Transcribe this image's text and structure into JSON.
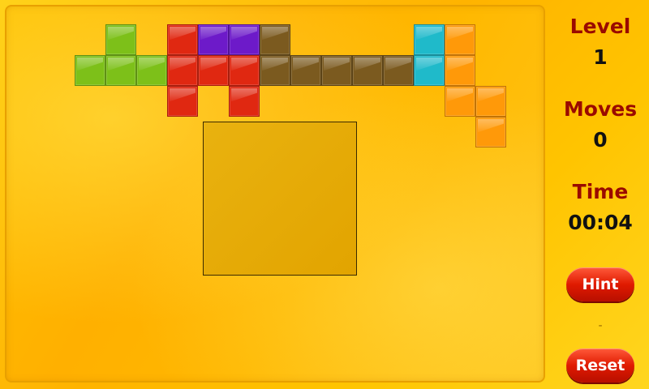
{
  "panel": {
    "level_label": "Level",
    "level_value": "1",
    "moves_label": "Moves",
    "moves_value": "0",
    "time_label": "Time",
    "time_value": "00:04",
    "hint_label": "Hint",
    "separator": "-",
    "reset_label": "Reset"
  },
  "pieces": [
    {
      "name": "green-piece",
      "color": "#7fbf20",
      "cells": [
        [
          2,
          0
        ],
        [
          1,
          1
        ],
        [
          2,
          1
        ],
        [
          3,
          1
        ]
      ]
    },
    {
      "name": "red-piece",
      "color": "#d92a14",
      "cells": [
        [
          4,
          0
        ],
        [
          4,
          1
        ],
        [
          5,
          1
        ],
        [
          6,
          1
        ],
        [
          4,
          2
        ],
        [
          6,
          2
        ]
      ]
    },
    {
      "name": "purple-piece",
      "color": "#6a1bc2",
      "cells": [
        [
          5,
          0
        ],
        [
          6,
          0
        ]
      ]
    },
    {
      "name": "brown-piece",
      "color": "#7a5a22",
      "cells": [
        [
          7,
          0
        ],
        [
          7,
          1
        ],
        [
          8,
          1
        ],
        [
          9,
          1
        ],
        [
          10,
          1
        ],
        [
          11,
          1
        ]
      ]
    },
    {
      "name": "cyan-piece",
      "color": "#25b8c8",
      "cells": [
        [
          12,
          0
        ],
        [
          12,
          1
        ]
      ]
    },
    {
      "name": "orange-piece",
      "color": "#ff9a10",
      "cells": [
        [
          13,
          0
        ],
        [
          13,
          1
        ],
        [
          13,
          2
        ],
        [
          14,
          2
        ],
        [
          14,
          3
        ]
      ]
    }
  ]
}
